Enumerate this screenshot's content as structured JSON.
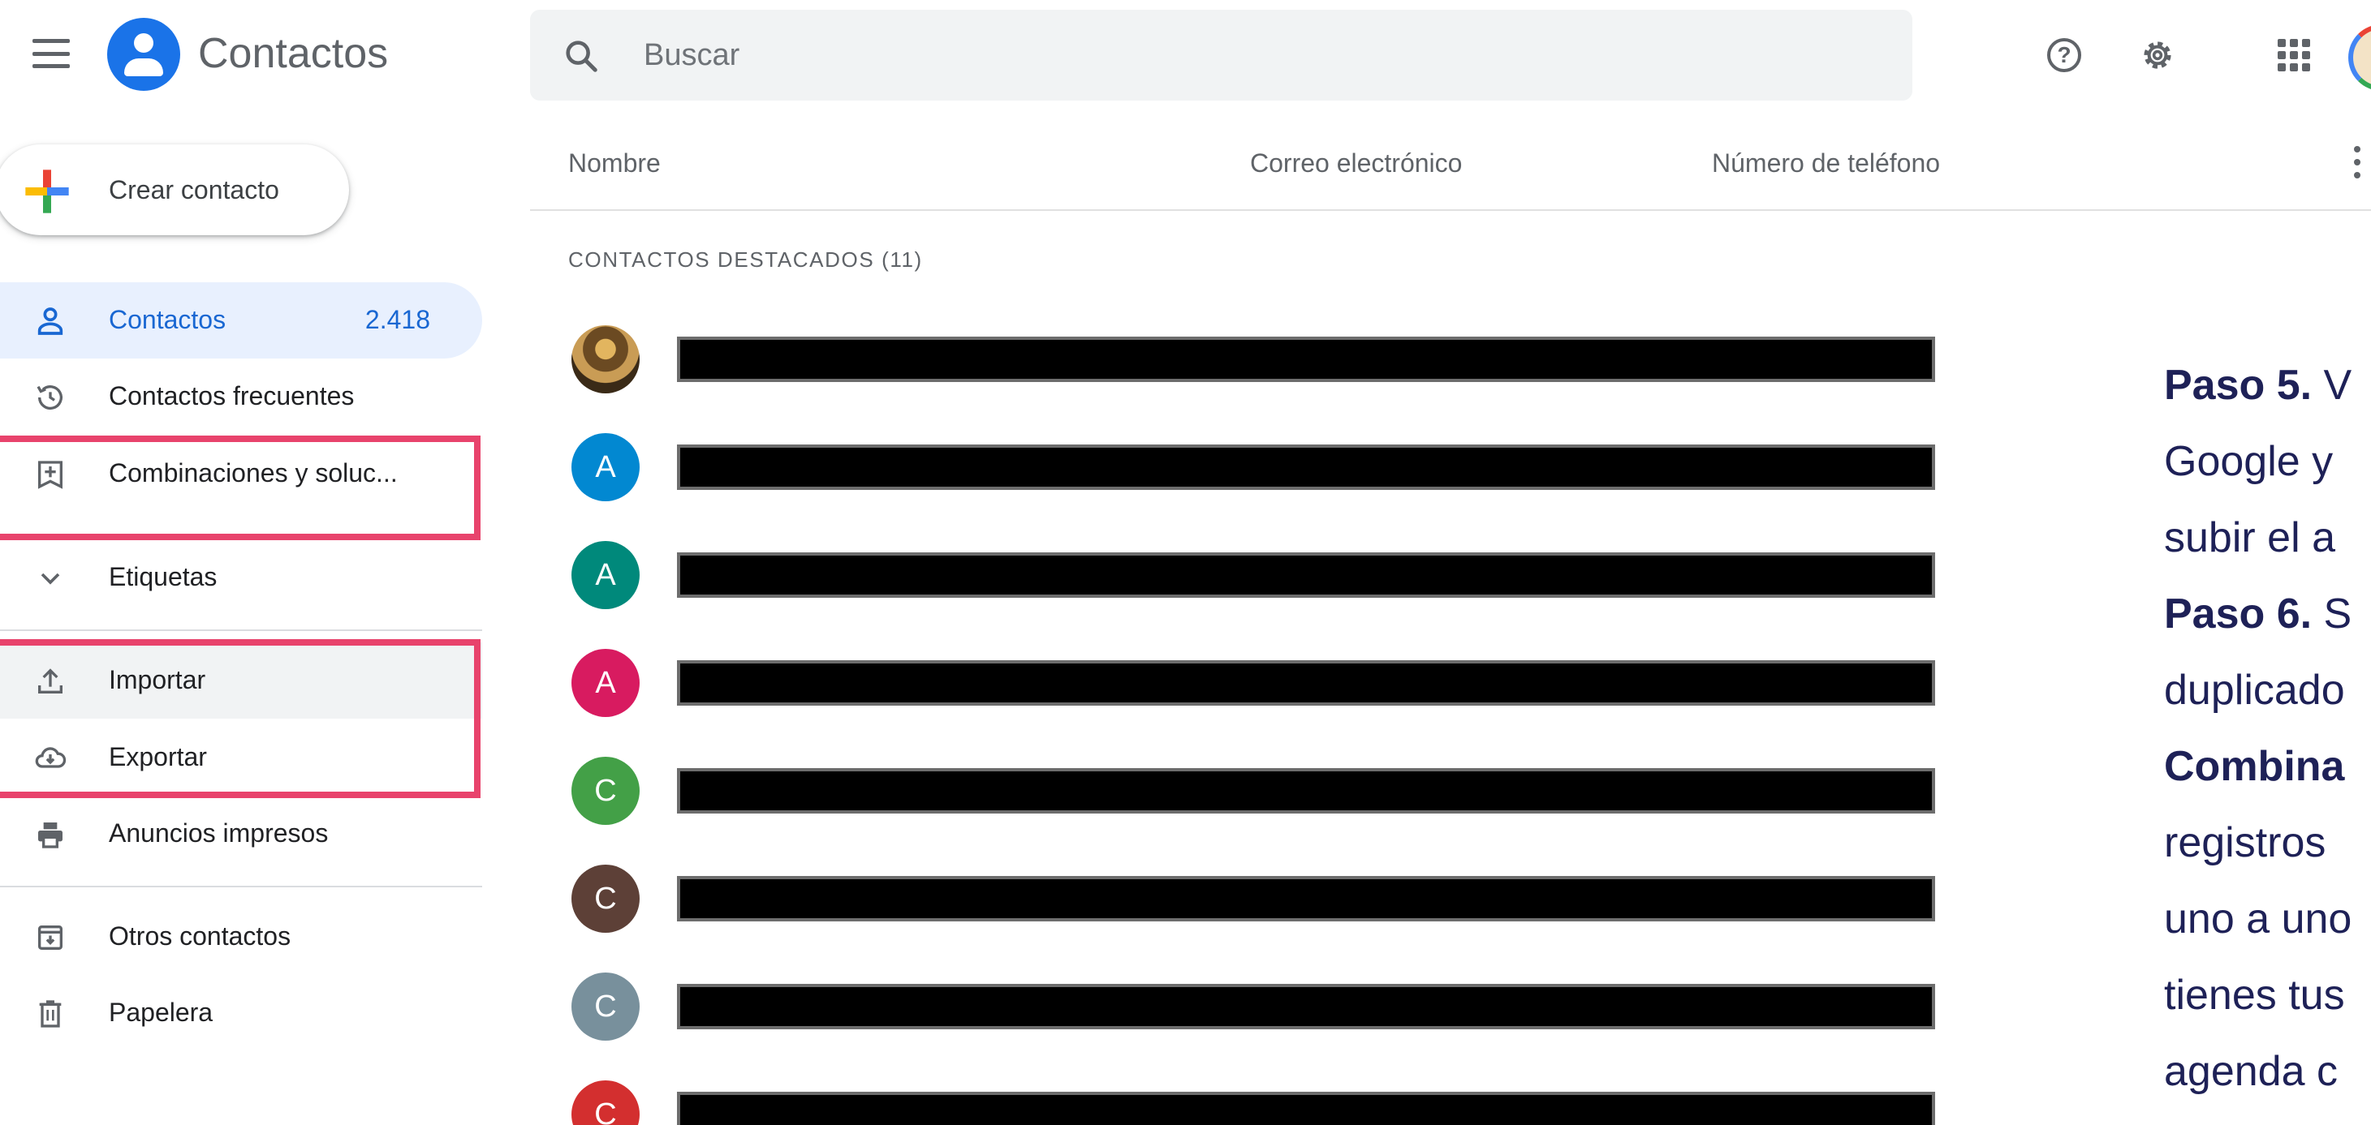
{
  "header": {
    "app_title": "Contactos",
    "search_placeholder": "Buscar",
    "help_glyph": "?",
    "icons": [
      "menu-icon",
      "contacts-logo-icon",
      "search-icon",
      "help-icon",
      "gear-icon",
      "apps-grid-icon",
      "account-avatar"
    ]
  },
  "sidebar": {
    "create_label": "Crear contacto",
    "items": [
      {
        "label": "Contactos",
        "count": "2.418",
        "icon": "person-icon"
      },
      {
        "label": "Contactos frecuentes",
        "icon": "history-icon"
      },
      {
        "label": "Combinaciones y soluc...",
        "icon": "merge-icon"
      },
      {
        "label": "Etiquetas",
        "icon": "chevron-down-icon"
      },
      {
        "label": "Importar",
        "icon": "upload-icon"
      },
      {
        "label": "Exportar",
        "icon": "cloud-download-icon"
      },
      {
        "label": "Anuncios impresos",
        "icon": "printer-icon"
      },
      {
        "label": "Otros contactos",
        "icon": "archive-icon"
      },
      {
        "label": "Papelera",
        "icon": "trash-icon"
      }
    ]
  },
  "table": {
    "columns": [
      "Nombre",
      "Correo electrónico",
      "Número de teléfono"
    ],
    "section_title": "CONTACTOS DESTACADOS (11)",
    "rows": [
      {
        "initial": "",
        "color": "#8a6a3a"
      },
      {
        "initial": "A",
        "color": "#0288d1"
      },
      {
        "initial": "A",
        "color": "#00897b"
      },
      {
        "initial": "A",
        "color": "#d81b60"
      },
      {
        "initial": "C",
        "color": "#43a047"
      },
      {
        "initial": "C",
        "color": "#5d4037"
      },
      {
        "initial": "C",
        "color": "#78909c"
      },
      {
        "initial": "C",
        "color": "#d32f2f"
      }
    ]
  },
  "panel": {
    "lines": [
      {
        "bold": "Paso 5.",
        "text": " V"
      },
      {
        "bold": "",
        "text": "Google y"
      },
      {
        "bold": "",
        "text": "subir el a"
      },
      {
        "bold": "Paso 6.",
        "text": " S"
      },
      {
        "bold": "",
        "text": "duplicado"
      },
      {
        "bold": "Combina",
        "text": ""
      },
      {
        "bold": "",
        "text": "registros"
      },
      {
        "bold": "",
        "text": "uno a uno"
      },
      {
        "bold": "",
        "text": "tienes tus"
      },
      {
        "bold": "",
        "text": "agenda c"
      }
    ]
  },
  "colors": {
    "brand_blue": "#1a73e8",
    "active_text": "#1967d2",
    "active_bg": "#e8f0fe",
    "highlight_border": "#e8436c",
    "panel_text": "#1e2157"
  }
}
